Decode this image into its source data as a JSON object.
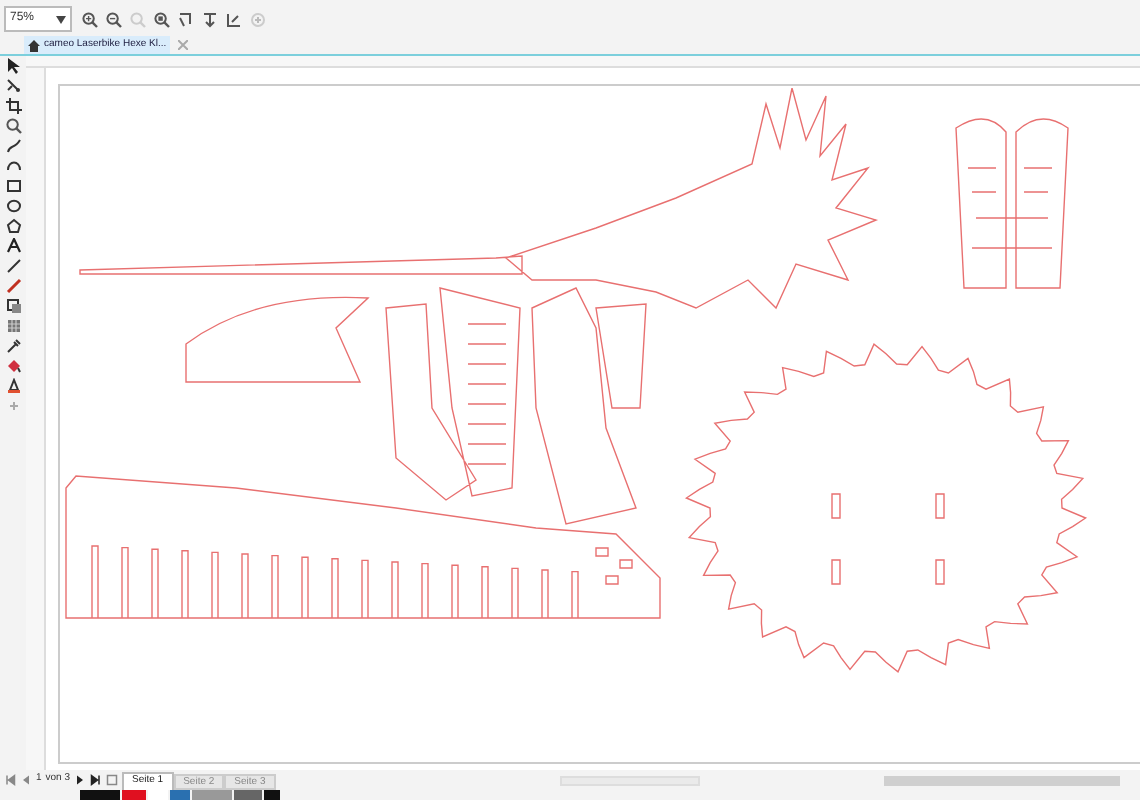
{
  "toolbar": {
    "zoom": "75%"
  },
  "document_tab": {
    "label": "cameo Laserbike Hexe Kl..."
  },
  "page_navigation": {
    "current": "1",
    "total": "von 3"
  },
  "pages": [
    {
      "label": "Seite 1",
      "selected": true
    },
    {
      "label": "Seite 2",
      "selected": false
    },
    {
      "label": "Seite 3",
      "selected": false
    }
  ]
}
